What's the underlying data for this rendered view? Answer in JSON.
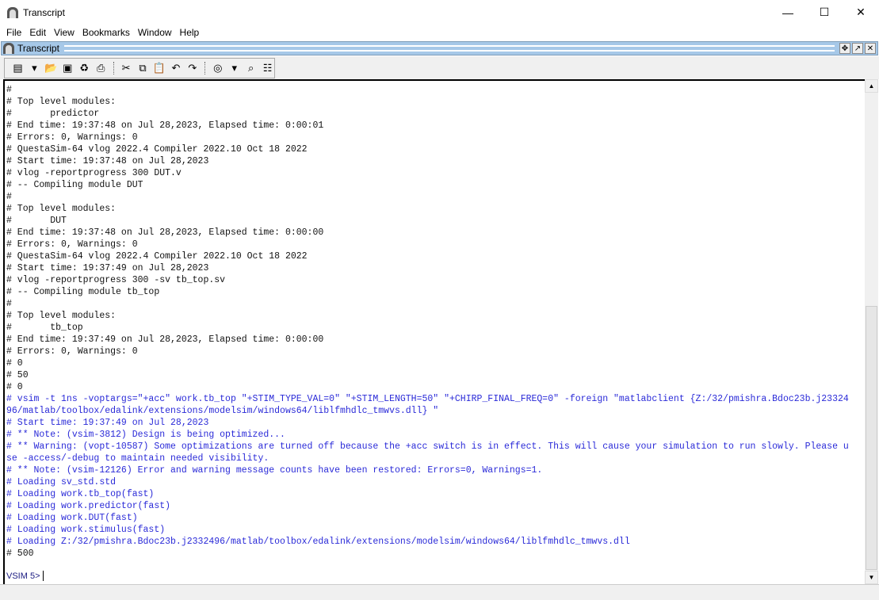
{
  "window": {
    "title": "Transcript",
    "minimize": "—",
    "maximize": "☐",
    "close": "✕"
  },
  "menu": [
    "File",
    "Edit",
    "View",
    "Bookmarks",
    "Window",
    "Help"
  ],
  "panel": {
    "title": "Transcript"
  },
  "toolbar": [
    {
      "name": "new-icon",
      "glyph": "▤"
    },
    {
      "name": "dropdown-icon",
      "glyph": "▾"
    },
    {
      "name": "open-folder-icon",
      "glyph": "📂"
    },
    {
      "name": "save-icon",
      "glyph": "▣"
    },
    {
      "name": "refresh-icon",
      "glyph": "♻"
    },
    {
      "name": "print-icon",
      "glyph": "⎙"
    },
    {
      "name": "cut-icon",
      "glyph": "✂"
    },
    {
      "name": "copy-icon",
      "glyph": "⧉"
    },
    {
      "name": "paste-icon",
      "glyph": "📋"
    },
    {
      "name": "undo-icon",
      "glyph": "↶"
    },
    {
      "name": "redo-icon",
      "glyph": "↷"
    },
    {
      "name": "find-icon",
      "glyph": "◎"
    },
    {
      "name": "find-dropdown-icon",
      "glyph": "▾"
    },
    {
      "name": "binoculars-icon",
      "glyph": "⌕"
    },
    {
      "name": "format-icon",
      "glyph": "☷"
    }
  ],
  "transcript": [
    {
      "t": "#",
      "c": "k"
    },
    {
      "t": "# Top level modules:",
      "c": "k"
    },
    {
      "t": "#       predictor",
      "c": "k"
    },
    {
      "t": "# End time: 19:37:48 on Jul 28,2023, Elapsed time: 0:00:01",
      "c": "k"
    },
    {
      "t": "# Errors: 0, Warnings: 0",
      "c": "k"
    },
    {
      "t": "# QuestaSim-64 vlog 2022.4 Compiler 2022.10 Oct 18 2022",
      "c": "k"
    },
    {
      "t": "# Start time: 19:37:48 on Jul 28,2023",
      "c": "k"
    },
    {
      "t": "# vlog -reportprogress 300 DUT.v",
      "c": "k"
    },
    {
      "t": "# -- Compiling module DUT",
      "c": "k"
    },
    {
      "t": "#",
      "c": "k"
    },
    {
      "t": "# Top level modules:",
      "c": "k"
    },
    {
      "t": "#       DUT",
      "c": "k"
    },
    {
      "t": "# End time: 19:37:48 on Jul 28,2023, Elapsed time: 0:00:00",
      "c": "k"
    },
    {
      "t": "# Errors: 0, Warnings: 0",
      "c": "k"
    },
    {
      "t": "# QuestaSim-64 vlog 2022.4 Compiler 2022.10 Oct 18 2022",
      "c": "k"
    },
    {
      "t": "# Start time: 19:37:49 on Jul 28,2023",
      "c": "k"
    },
    {
      "t": "# vlog -reportprogress 300 -sv tb_top.sv",
      "c": "k"
    },
    {
      "t": "# -- Compiling module tb_top",
      "c": "k"
    },
    {
      "t": "#",
      "c": "k"
    },
    {
      "t": "# Top level modules:",
      "c": "k"
    },
    {
      "t": "#       tb_top",
      "c": "k"
    },
    {
      "t": "# End time: 19:37:49 on Jul 28,2023, Elapsed time: 0:00:00",
      "c": "k"
    },
    {
      "t": "# Errors: 0, Warnings: 0",
      "c": "k"
    },
    {
      "t": "# 0",
      "c": "k"
    },
    {
      "t": "# 50",
      "c": "k"
    },
    {
      "t": "# 0",
      "c": "k"
    },
    {
      "t": "# vsim -t 1ns -voptargs=\"+acc\" work.tb_top \"+STIM_TYPE_VAL=0\" \"+STIM_LENGTH=50\" \"+CHIRP_FINAL_FREQ=0\" -foreign \"matlabclient {Z:/32/pmishra.Bdoc23b.j23324",
      "c": "b"
    },
    {
      "t": "96/matlab/toolbox/edalink/extensions/modelsim/windows64/liblfmhdlc_tmwvs.dll} \"",
      "c": "b"
    },
    {
      "t": "# Start time: 19:37:49 on Jul 28,2023",
      "c": "b"
    },
    {
      "t": "# ** Note: (vsim-3812) Design is being optimized...",
      "c": "b"
    },
    {
      "t": "# ** Warning: (vopt-10587) Some optimizations are turned off because the +acc switch is in effect. This will cause your simulation to run slowly. Please u",
      "c": "b"
    },
    {
      "t": "se -access/-debug to maintain needed visibility.",
      "c": "b"
    },
    {
      "t": "# ** Note: (vsim-12126) Error and warning message counts have been restored: Errors=0, Warnings=1.",
      "c": "b"
    },
    {
      "t": "# Loading sv_std.std",
      "c": "b"
    },
    {
      "t": "# Loading work.tb_top(fast)",
      "c": "b"
    },
    {
      "t": "# Loading work.predictor(fast)",
      "c": "b"
    },
    {
      "t": "# Loading work.DUT(fast)",
      "c": "b"
    },
    {
      "t": "# Loading work.stimulus(fast)",
      "c": "b"
    },
    {
      "t": "# Loading Z:/32/pmishra.Bdoc23b.j2332496/matlab/toolbox/edalink/extensions/modelsim/windows64/liblfmhdlc_tmwvs.dll",
      "c": "b"
    },
    {
      "t": "# 500",
      "c": "k"
    }
  ],
  "prompt": "VSIM 5>"
}
